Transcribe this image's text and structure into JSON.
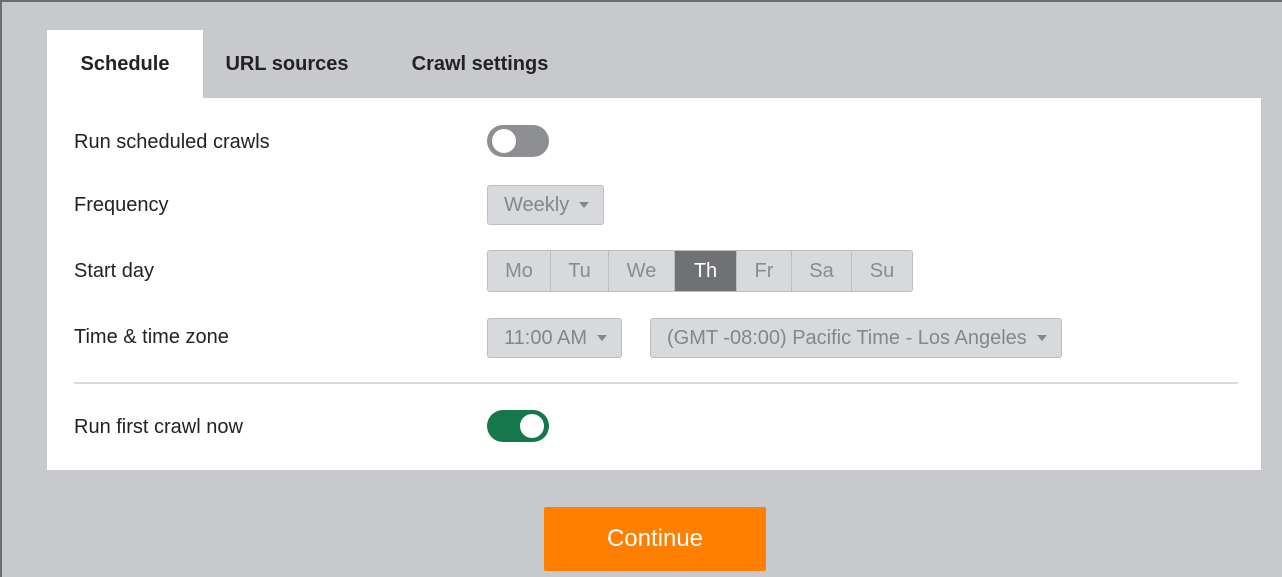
{
  "tabs": [
    {
      "label": "Schedule",
      "active": true
    },
    {
      "label": "URL sources",
      "active": false
    },
    {
      "label": "Crawl settings",
      "active": false
    }
  ],
  "schedule": {
    "run_scheduled_label": "Run scheduled crawls",
    "run_scheduled_on": false,
    "frequency_label": "Frequency",
    "frequency_value": "Weekly",
    "start_day_label": "Start day",
    "days": [
      "Mo",
      "Tu",
      "We",
      "Th",
      "Fr",
      "Sa",
      "Su"
    ],
    "selected_day": "Th",
    "time_zone_label": "Time & time zone",
    "time_value": "11:00 AM",
    "timezone_value": "(GMT -08:00) Pacific Time - Los Angeles",
    "run_first_label": "Run first crawl now",
    "run_first_on": true
  },
  "continue_label": "Continue",
  "colors": {
    "accent_orange": "#ff7f00",
    "toggle_on_green": "#14784a",
    "toggle_off_gray": "#8e8f92",
    "selected_day_bg": "#707174"
  }
}
